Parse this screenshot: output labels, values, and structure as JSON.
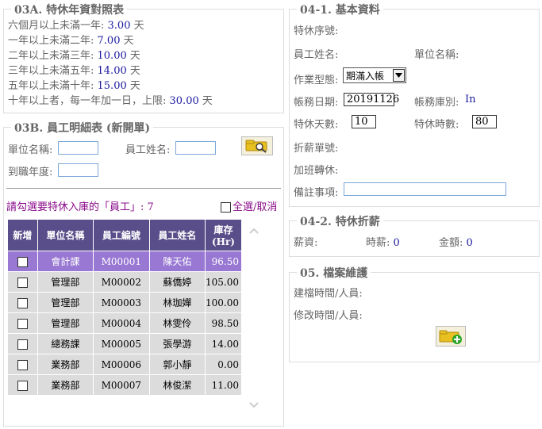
{
  "seniority": {
    "title": "03A. 特休年資對照表",
    "rows": [
      {
        "label": "六個月以上未滿一年: ",
        "value": "3.00",
        "unit": " 天"
      },
      {
        "label": "一年以上未滿二年: ",
        "value": "7.00",
        "unit": " 天"
      },
      {
        "label": "二年以上未滿三年: ",
        "value": "10.00",
        "unit": " 天"
      },
      {
        "label": "三年以上未滿五年: ",
        "value": "14.00",
        "unit": " 天"
      },
      {
        "label": "五年以上未滿十年: ",
        "value": "15.00",
        "unit": " 天"
      }
    ],
    "last_label": "十年以上者，每一年加一日，上限: ",
    "last_value": "30.00",
    "last_unit": " 天"
  },
  "employee": {
    "title": "03B. 員工明細表 (新開單)",
    "unit_label": "單位名稱:",
    "name_label": "員工姓名:",
    "year_label": "到職年度:",
    "prompt": "請勾選要特休入庫的「員工」: 7",
    "select_all": "全選/取消",
    "columns": [
      "新增",
      "單位名稱",
      "員工編號",
      "員工姓名",
      "庫存\n(Hr)"
    ],
    "rows": [
      {
        "unit": "會計課",
        "id": "M00001",
        "name": "陳天佑",
        "stock": "96.50"
      },
      {
        "unit": "管理部",
        "id": "M00002",
        "name": "蘇僑婷",
        "stock": "105.00"
      },
      {
        "unit": "管理部",
        "id": "M00003",
        "name": "林珈嬋",
        "stock": "100.00"
      },
      {
        "unit": "管理部",
        "id": "M00004",
        "name": "林雯伶",
        "stock": "98.50"
      },
      {
        "unit": "總務課",
        "id": "M00005",
        "name": "張學游",
        "stock": "14.00"
      },
      {
        "unit": "業務部",
        "id": "M00006",
        "name": "郭小靜",
        "stock": "0.00"
      },
      {
        "unit": "業務部",
        "id": "M00007",
        "name": "林俊潔",
        "stock": "11.00"
      }
    ]
  },
  "basic": {
    "title": "04-1. 基本資料",
    "seq_label": "特休序號:",
    "emp_name_label": "員工姓名:",
    "unit_name_label": "單位名稱:",
    "op_type_label": "作業型態:",
    "op_type_value": "期滿入帳",
    "date_label": "帳務日期:",
    "date_value": "20191126",
    "acct_type_label": "帳務庫別:",
    "acct_type_value": "In",
    "days_label": "特休天數:",
    "days_value": "10",
    "hours_label": "特休時數:",
    "hours_value": "80",
    "discount_label": "折薪單號:",
    "overtime_label": "加班轉休:",
    "note_label": "備註事項:",
    "note_value": ""
  },
  "discount": {
    "title": "04-2. 特休折薪",
    "salary_label": "薪資:",
    "hourly_label": "時薪:",
    "hourly_value": "0",
    "amount_label": "金額:",
    "amount_value": "0"
  },
  "maintenance": {
    "title": "05. 檔案維護",
    "created_label": "建檔時間/人員:",
    "modified_label": "修改時間/人員:"
  }
}
